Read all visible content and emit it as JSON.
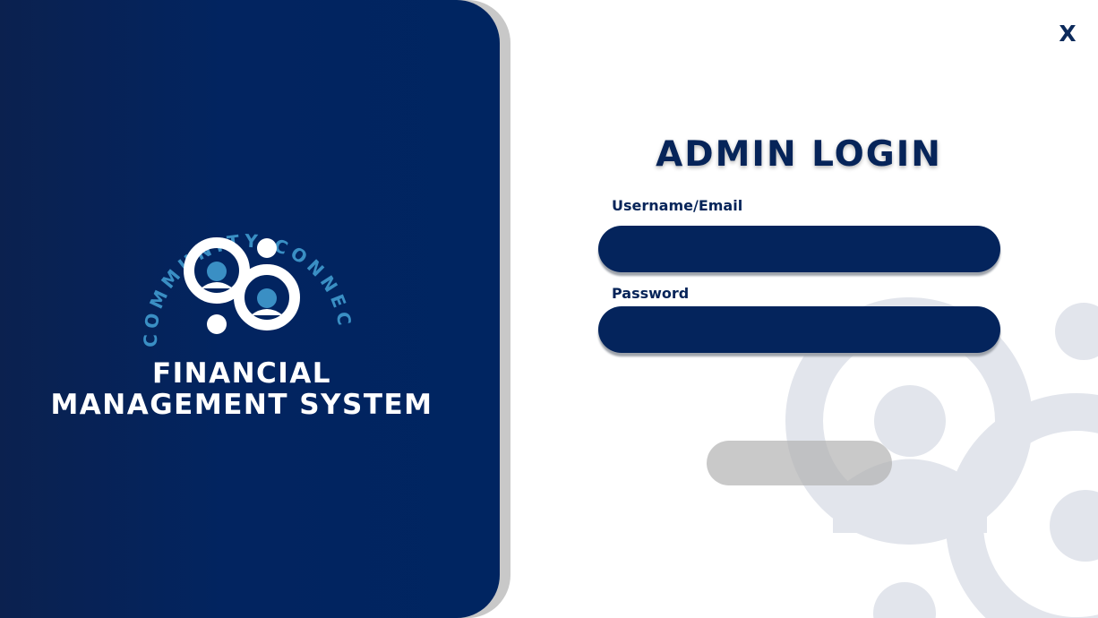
{
  "branding": {
    "logo_text": "COMMUNITY CONNECT",
    "system_name_line1": "FINANCIAL",
    "system_name_line2": "MANAGEMENT SYSTEM"
  },
  "window": {
    "close_label": "X"
  },
  "login": {
    "title": "ADMIN LOGIN",
    "username_label": "Username/Email",
    "username_value": "",
    "password_label": "Password",
    "password_value": "",
    "submit_label": ""
  },
  "icons": {
    "logo": "community-connect-logo-icon",
    "background": "people-background-icon"
  },
  "colors": {
    "navy": "#002561",
    "panel_dark": "#0b214f",
    "logo_blue": "#3a8fc4",
    "deco_gray": "#e2e5ec",
    "button_gray": "#b8b8b8"
  }
}
